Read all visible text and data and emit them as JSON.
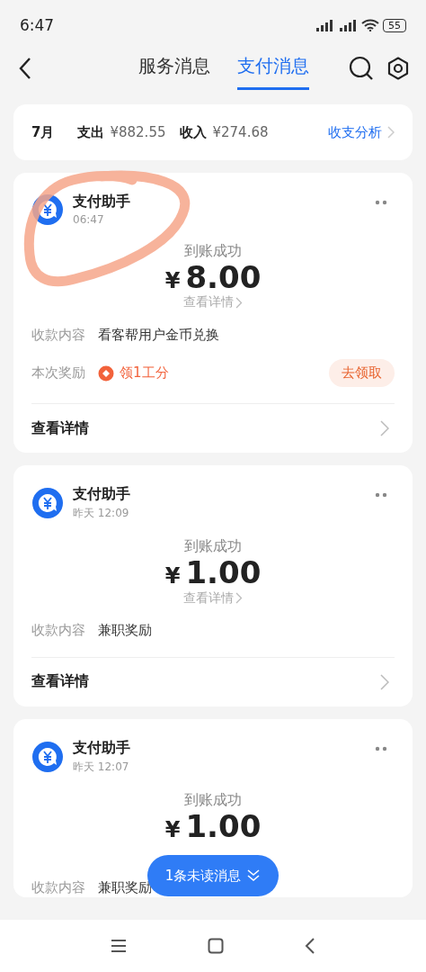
{
  "status_bar": {
    "time": "6:47",
    "battery": "55"
  },
  "header": {
    "tabs": [
      {
        "label": "服务消息",
        "selected": false
      },
      {
        "label": "支付消息",
        "selected": true
      }
    ]
  },
  "summary": {
    "month": "7月",
    "expense_label": "支出",
    "expense": "¥882.55",
    "income_label": "收入",
    "income": "¥274.68",
    "analysis_link": "收支分析"
  },
  "messages": [
    {
      "sender": "支付助手",
      "time": "06:47",
      "status": "到账成功",
      "currency": "¥",
      "amount": "8.00",
      "detail_link": "查看详情",
      "annotated": true,
      "fields": [
        {
          "kind": "text",
          "label": "收款内容",
          "value": "看客帮用户金币兑换"
        },
        {
          "kind": "reward",
          "label": "本次奖励",
          "value": "领1工分",
          "action": "去领取"
        }
      ],
      "footer": "查看详情"
    },
    {
      "sender": "支付助手",
      "time": "昨天 12:09",
      "status": "到账成功",
      "currency": "¥",
      "amount": "1.00",
      "detail_link": "查看详情",
      "annotated": false,
      "fields": [
        {
          "kind": "text",
          "label": "收款内容",
          "value": "兼职奖励"
        }
      ],
      "footer": "查看详情"
    },
    {
      "sender": "支付助手",
      "time": "昨天 12:07",
      "status": "到账成功",
      "currency": "¥",
      "amount": "1.00",
      "annotated": false,
      "fields": [
        {
          "kind": "text",
          "label": "收款内容",
          "value": "兼职奖励"
        }
      ]
    }
  ],
  "unread_pill": "1条未读消息"
}
